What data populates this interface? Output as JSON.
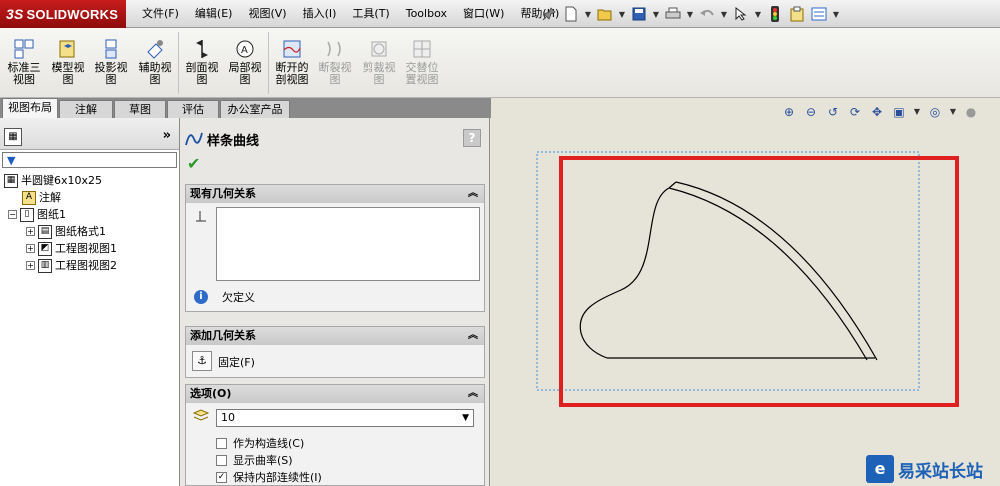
{
  "app": {
    "brand": "SOLIDWORKS",
    "brand_prefix": "3S"
  },
  "menu": {
    "items": [
      "文件(F)",
      "编辑(E)",
      "视图(V)",
      "插入(I)",
      "工具(T)",
      "Toolbox",
      "窗口(W)",
      "帮助(H)"
    ]
  },
  "toolbar": {
    "icons": [
      "pin-icon",
      "new-document-icon",
      "open-icon",
      "save-icon",
      "print-icon",
      "undo-icon",
      "select-icon",
      "rebuild-icon",
      "file-properties-icon",
      "options-icon"
    ]
  },
  "commands": [
    {
      "label": "标准三\n视图",
      "enabled": true
    },
    {
      "label": "模型视\n图",
      "enabled": true
    },
    {
      "label": "投影视\n图",
      "enabled": true
    },
    {
      "label": "辅助视\n图",
      "enabled": true
    },
    {
      "label": "剖面视\n图",
      "enabled": true
    },
    {
      "label": "局部视\n图",
      "enabled": true
    },
    {
      "label": "断开的\n剖视图",
      "enabled": true
    },
    {
      "label": "断裂视\n图",
      "enabled": false
    },
    {
      "label": "剪裁视\n图",
      "enabled": false
    },
    {
      "label": "交替位\n置视图",
      "enabled": false
    }
  ],
  "tabs": [
    "视图布局",
    "注解",
    "草图",
    "评估",
    "办公室产品"
  ],
  "active_tab": "视图布局",
  "tree": {
    "more_symbol": "»",
    "root": "半圆键6x10x25",
    "annotations": "注解",
    "sheet": "图纸1",
    "children": [
      "图纸格式1",
      "工程图视图1",
      "工程图视图2"
    ]
  },
  "property_manager": {
    "title": "样条曲线",
    "help": "?",
    "existing_relations": {
      "header": "现有几何关系",
      "status": "欠定义"
    },
    "add_relations": {
      "header": "添加几何关系",
      "fix_label": "固定(F)"
    },
    "options": {
      "header": "选项(O)",
      "select_value": "10",
      "checkboxes": [
        {
          "label": "作为构造线(C)",
          "checked": false
        },
        {
          "label": "显示曲率(S)",
          "checked": false
        },
        {
          "label": "保持内部连续性(I)",
          "checked": true
        }
      ]
    }
  },
  "canvas": {
    "background": "#e6e4d8",
    "highlight_color": "#e02020",
    "selection_color": "#3b8fe0"
  },
  "watermark": {
    "text": "易采站长站",
    "logo_text": "e"
  }
}
